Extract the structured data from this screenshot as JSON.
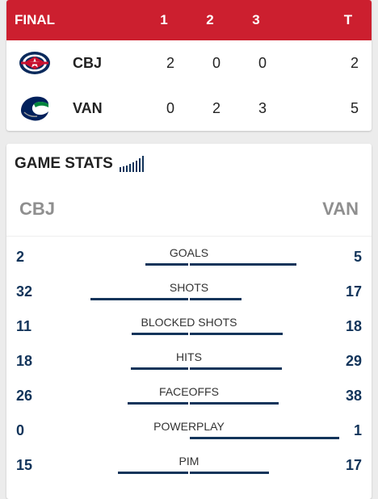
{
  "scoreboard": {
    "status": "FINAL",
    "periods": [
      "1",
      "2",
      "3"
    ],
    "total_label": "T",
    "accent_color": "#cc1f2f",
    "teams": [
      {
        "abbr": "CBJ",
        "logo_icon": "blue-jackets-logo-icon",
        "periods": [
          "2",
          "0",
          "0"
        ],
        "total": "2"
      },
      {
        "abbr": "VAN",
        "logo_icon": "canucks-logo-icon",
        "periods": [
          "0",
          "2",
          "3"
        ],
        "total": "5"
      }
    ]
  },
  "game_stats": {
    "title": "GAME STATS",
    "title_icon": "stats-bars-icon",
    "home_label": "CBJ",
    "away_label": "VAN",
    "bar_color": "#12345a",
    "rows": [
      {
        "label": "GOALS",
        "left": "2",
        "right": "5"
      },
      {
        "label": "SHOTS",
        "left": "32",
        "right": "17"
      },
      {
        "label": "BLOCKED SHOTS",
        "left": "11",
        "right": "18"
      },
      {
        "label": "HITS",
        "left": "18",
        "right": "29"
      },
      {
        "label": "FACEOFFS",
        "left": "26",
        "right": "38"
      },
      {
        "label": "POWERPLAY",
        "left": "0",
        "right": "1"
      },
      {
        "label": "PIM",
        "left": "15",
        "right": "17"
      }
    ]
  }
}
